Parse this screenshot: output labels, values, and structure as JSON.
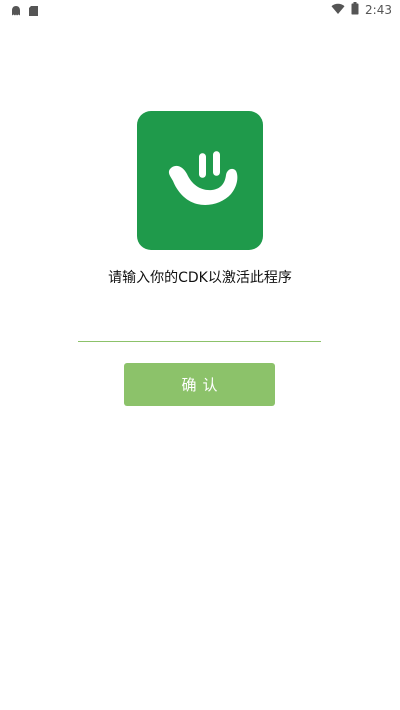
{
  "status_bar": {
    "time": "2:43",
    "left_icons": [
      "ghost-notification-icon",
      "sd-card-icon"
    ],
    "right_icons": [
      "wifi-icon",
      "battery-icon"
    ]
  },
  "app": {
    "icon": "smiley-hand-logo-icon",
    "brand_color": "#1f9a4b"
  },
  "activation": {
    "prompt": "请输入你的CDK以激活此程序",
    "input_value": "",
    "input_placeholder": "",
    "confirm_label": "确认",
    "accent_color": "#8cc26a"
  }
}
